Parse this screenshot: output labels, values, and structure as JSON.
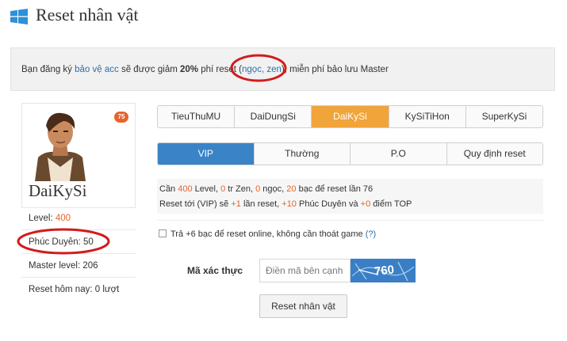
{
  "header": {
    "title": "Reset nhân vật",
    "icon": "windows-icon"
  },
  "notice": {
    "part1": "Bạn đăng ký ",
    "link": "bảo vệ acc",
    "part2": " sẽ được giảm ",
    "discount": "20%",
    "part3": " phí reset (",
    "highlight": "ngọc, zen",
    "part4": "), miễn phí bảo lưu Master"
  },
  "profile": {
    "badge": "75",
    "name": "DaiKySi",
    "level_label": "Level: ",
    "level_value": "400",
    "phuc_duyen": "Phúc Duyên: 50",
    "master_level": "Master level: 206",
    "reset_today": "Reset hôm nay: 0 lượt"
  },
  "class_tabs": [
    "TieuThuMU",
    "DaiDungSi",
    "DaiKySi",
    "KySiTiHon",
    "SuperKySi"
  ],
  "mode_tabs": [
    "VIP",
    "Thường",
    "P.O",
    "Quy định reset"
  ],
  "info": {
    "l1_a": "Cần ",
    "l1_level": "400",
    "l1_b": " Level, ",
    "l1_zen": "0",
    "l1_c": " tr Zen, ",
    "l1_ngoc": "0",
    "l1_d": " ngọc, ",
    "l1_bac": "20",
    "l1_e": " bạc để reset lần 76",
    "l2_a": "Reset tới (VIP) sẽ ",
    "l2_reset": "+1",
    "l2_b": " lần reset, ",
    "l2_pd": "+10",
    "l2_c": " Phúc Duyên và ",
    "l2_top": "+0",
    "l2_d": " điểm TOP"
  },
  "online_option": {
    "label": "Trả +6 bạc để reset online, không cần thoát game ",
    "help": "(?)"
  },
  "captcha": {
    "label": "Mã xác thực",
    "placeholder": "Điền mã bên cạnh",
    "code": "760"
  },
  "submit_label": "Reset nhân vật",
  "colors": {
    "accent_orange": "#f0a43a",
    "accent_blue": "#3a83c7",
    "red_text": "#e8632c",
    "annotation_red": "#d21b1b"
  }
}
